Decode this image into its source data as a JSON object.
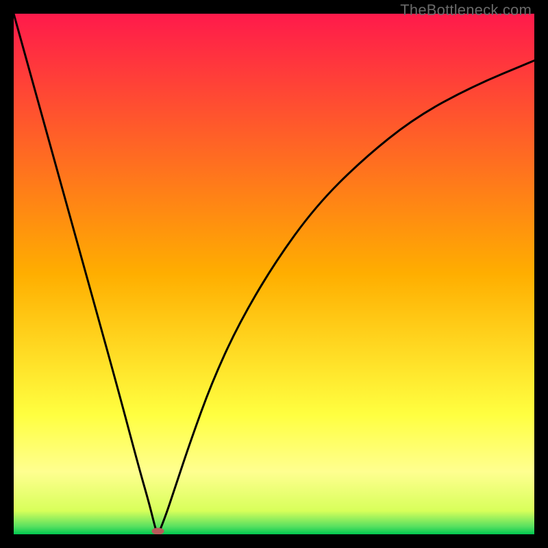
{
  "watermark": "TheBottleneck.com",
  "chart_data": {
    "type": "line",
    "title": "",
    "xlabel": "",
    "ylabel": "",
    "xlim": [
      0,
      100
    ],
    "ylim": [
      0,
      100
    ],
    "grid": false,
    "legend": false,
    "background_gradient": [
      {
        "stop": 0.0,
        "color": "#ff1a4b"
      },
      {
        "stop": 0.5,
        "color": "#ffae00"
      },
      {
        "stop": 0.77,
        "color": "#ffff40"
      },
      {
        "stop": 0.88,
        "color": "#ffff90"
      },
      {
        "stop": 0.955,
        "color": "#d8ff5a"
      },
      {
        "stop": 0.985,
        "color": "#58e060"
      },
      {
        "stop": 1.0,
        "color": "#00c850"
      }
    ],
    "series": [
      {
        "name": "left-branch",
        "x": [
          0,
          5,
          10,
          15,
          20,
          24,
          26,
          27,
          27.4
        ],
        "y": [
          100,
          82,
          64,
          46,
          28,
          13,
          6,
          2,
          0.6
        ]
      },
      {
        "name": "right-branch",
        "x": [
          28.0,
          29,
          31,
          34,
          38,
          43,
          50,
          58,
          67,
          77,
          88,
          100
        ],
        "y": [
          0.6,
          3,
          9,
          18,
          29,
          40,
          52,
          63,
          72,
          80,
          86,
          91
        ]
      }
    ],
    "marker": {
      "name": "minimum-marker",
      "x": 27.7,
      "y": 0.6,
      "color": "#b85a5a",
      "rx": 9,
      "ry": 5
    }
  }
}
